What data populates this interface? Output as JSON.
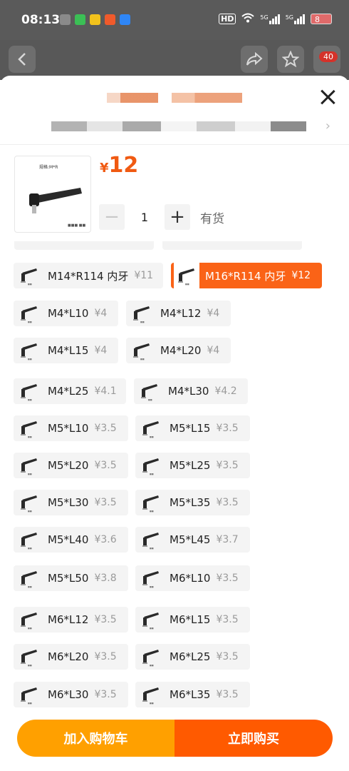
{
  "status_bar": {
    "time": "08:13",
    "hd": "HD",
    "net1": "5G",
    "net2": "5G",
    "battery": "8"
  },
  "header": {
    "badge": "40"
  },
  "product": {
    "price_symbol": "¥",
    "price": "12",
    "thumb_caption": "规格:M*R",
    "quantity": "1",
    "stock": "有货"
  },
  "options": [
    {
      "name": "M14*R114 内牙",
      "price": "¥11"
    },
    {
      "name": "M16*R114 内牙",
      "price": "¥12",
      "selected": true
    },
    {
      "name": "M4*L10",
      "price": "¥4"
    },
    {
      "name": "M4*L12",
      "price": "¥4"
    },
    {
      "name": "M4*L15",
      "price": "¥4"
    },
    {
      "name": "M4*L20",
      "price": "¥4"
    },
    {
      "name": "M4*L25",
      "price": "¥4.1"
    },
    {
      "name": "M4*L30",
      "price": "¥4.2"
    },
    {
      "name": "M5*L10",
      "price": "¥3.5"
    },
    {
      "name": "M5*L15",
      "price": "¥3.5"
    },
    {
      "name": "M5*L20",
      "price": "¥3.5"
    },
    {
      "name": "M5*L25",
      "price": "¥3.5"
    },
    {
      "name": "M5*L30",
      "price": "¥3.5"
    },
    {
      "name": "M5*L35",
      "price": "¥3.5"
    },
    {
      "name": "M5*L40",
      "price": "¥3.6"
    },
    {
      "name": "M5*L45",
      "price": "¥3.7"
    },
    {
      "name": "M5*L50",
      "price": "¥3.8"
    },
    {
      "name": "M6*L10",
      "price": "¥3.5"
    },
    {
      "name": "M6*L12",
      "price": "¥3.5"
    },
    {
      "name": "M6*L15",
      "price": "¥3.5"
    },
    {
      "name": "M6*L20",
      "price": "¥3.5"
    },
    {
      "name": "M6*L25",
      "price": "¥3.5"
    },
    {
      "name": "M6*L30",
      "price": "¥3.5"
    },
    {
      "name": "M6*L35",
      "price": "¥3.5"
    }
  ],
  "actions": {
    "add_to_cart": "加入购物车",
    "buy_now": "立即购买"
  },
  "colors": {
    "accent": "#fa6317",
    "cart": "#ffa000",
    "buy": "#ff5a00"
  }
}
